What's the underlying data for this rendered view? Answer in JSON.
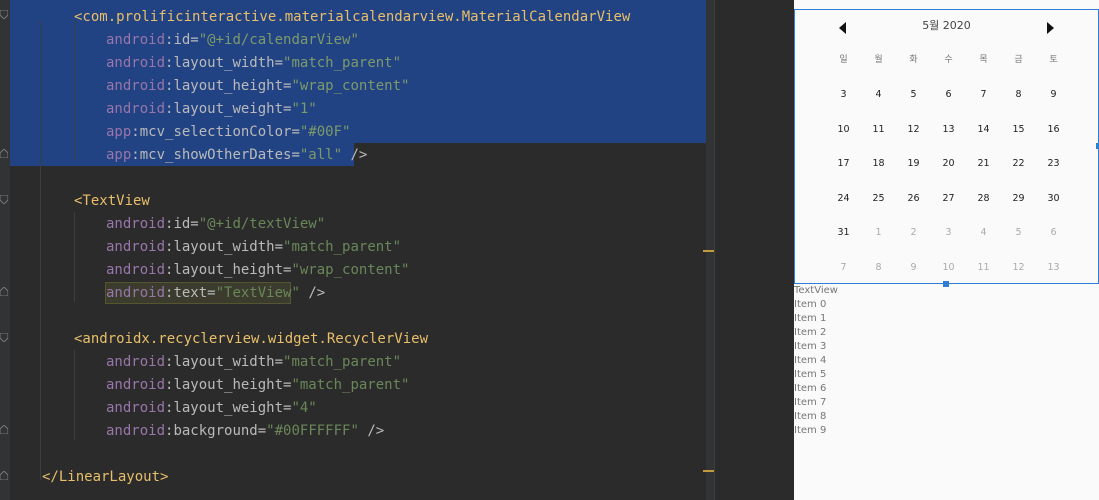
{
  "editor": {
    "lines": [
      {
        "parts": [
          [
            "tag",
            "<com.prolificinteractive.materialcalendarview.MaterialCalendarView"
          ]
        ]
      },
      {
        "parts": [
          [
            "ns",
            "android"
          ],
          [
            "at",
            ":id="
          ],
          [
            "val",
            "\"@+id/calendarView\""
          ]
        ]
      },
      {
        "parts": [
          [
            "ns",
            "android"
          ],
          [
            "at",
            ":layout_width="
          ],
          [
            "val",
            "\"match_parent\""
          ]
        ]
      },
      {
        "parts": [
          [
            "ns",
            "android"
          ],
          [
            "at",
            ":layout_height="
          ],
          [
            "val",
            "\"wrap_content\""
          ]
        ]
      },
      {
        "parts": [
          [
            "ns",
            "android"
          ],
          [
            "at",
            ":layout_weight="
          ],
          [
            "val",
            "\"1\""
          ]
        ]
      },
      {
        "parts": [
          [
            "ns",
            "app"
          ],
          [
            "at",
            ":mcv_selectionColor="
          ],
          [
            "val",
            "\"#00F\""
          ]
        ]
      },
      {
        "parts": [
          [
            "ns",
            "app"
          ],
          [
            "at",
            ":mcv_showOtherDates="
          ],
          [
            "val",
            "\"all\""
          ],
          [
            "at",
            " />"
          ]
        ]
      },
      {
        "parts": []
      },
      {
        "parts": [
          [
            "tag",
            "<TextView"
          ]
        ]
      },
      {
        "parts": [
          [
            "ns",
            "android"
          ],
          [
            "at",
            ":id="
          ],
          [
            "val",
            "\"@+id/textView\""
          ]
        ]
      },
      {
        "parts": [
          [
            "ns",
            "android"
          ],
          [
            "at",
            ":layout_width="
          ],
          [
            "val",
            "\"match_parent\""
          ]
        ]
      },
      {
        "parts": [
          [
            "ns",
            "android"
          ],
          [
            "at",
            ":layout_height="
          ],
          [
            "val",
            "\"wrap_content\""
          ]
        ]
      },
      {
        "parts": [
          [
            "ns",
            "android"
          ],
          [
            "at",
            ":text="
          ],
          [
            "val",
            "\"TextView\""
          ],
          [
            "at",
            " />"
          ]
        ]
      },
      {
        "parts": []
      },
      {
        "parts": [
          [
            "tag",
            "<androidx.recyclerview.widget.RecyclerView"
          ]
        ]
      },
      {
        "parts": [
          [
            "ns",
            "android"
          ],
          [
            "at",
            ":layout_width="
          ],
          [
            "val",
            "\"match_parent\""
          ]
        ]
      },
      {
        "parts": [
          [
            "ns",
            "android"
          ],
          [
            "at",
            ":layout_height="
          ],
          [
            "val",
            "\"match_parent\""
          ]
        ]
      },
      {
        "parts": [
          [
            "ns",
            "android"
          ],
          [
            "at",
            ":layout_weight="
          ],
          [
            "val",
            "\"4\""
          ]
        ]
      },
      {
        "parts": [
          [
            "ns",
            "android"
          ],
          [
            "at",
            ":background="
          ],
          [
            "val",
            "\"#00FFFFFF\""
          ],
          [
            "at",
            " />"
          ]
        ]
      },
      {
        "parts": []
      },
      {
        "parts": [
          [
            "tag",
            "</LinearLayout>"
          ]
        ]
      }
    ]
  },
  "calendar": {
    "title": "5월 2020",
    "weekdays": [
      "일",
      "월",
      "화",
      "수",
      "목",
      "금",
      "토"
    ],
    "weeks": [
      [
        "3",
        "4",
        "5",
        "6",
        "7",
        "8",
        "9"
      ],
      [
        "10",
        "11",
        "12",
        "13",
        "14",
        "15",
        "16"
      ],
      [
        "17",
        "18",
        "19",
        "20",
        "21",
        "22",
        "23"
      ],
      [
        "24",
        "25",
        "26",
        "27",
        "28",
        "29",
        "30"
      ],
      [
        "31",
        "1",
        "2",
        "3",
        "4",
        "5",
        "6"
      ],
      [
        "7",
        "8",
        "9",
        "10",
        "11",
        "12",
        "13"
      ]
    ]
  },
  "preview": {
    "textview": "TextView",
    "items": [
      "Item 0",
      "Item 1",
      "Item 2",
      "Item 3",
      "Item 4",
      "Item 5",
      "Item 6",
      "Item 7",
      "Item 8",
      "Item 9"
    ]
  },
  "colors": {
    "selection": "#214283",
    "accent": "#2e7dd6",
    "tag": "#e8bf6a",
    "namespace": "#9876aa",
    "value": "#6a8759"
  }
}
